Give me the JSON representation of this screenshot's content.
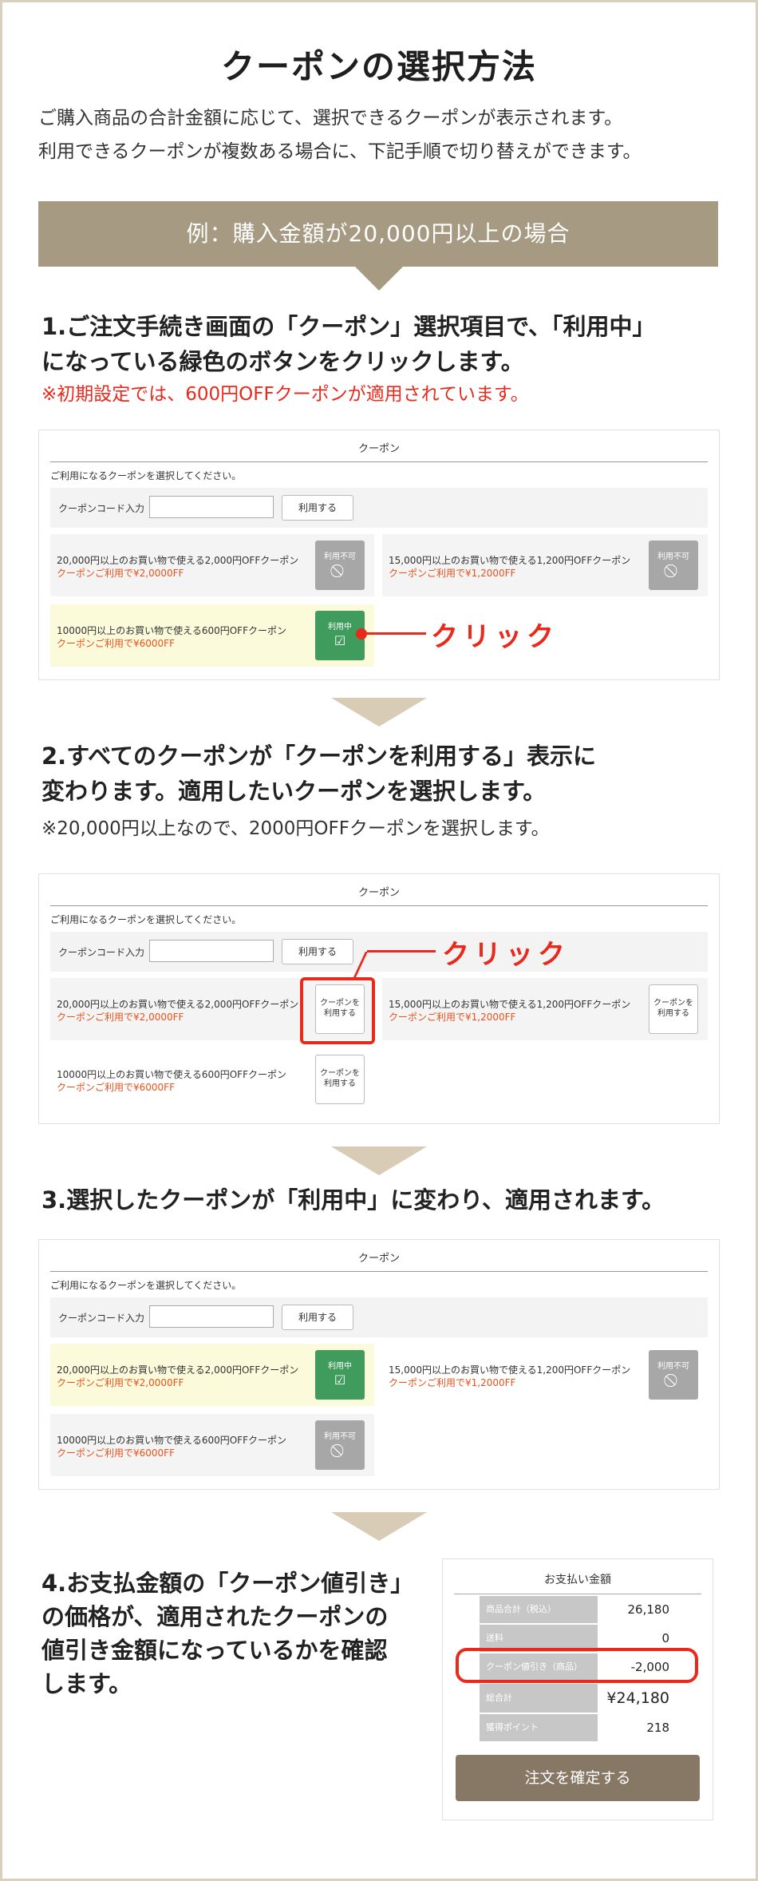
{
  "page": {
    "title": "クーポンの選択方法",
    "intro": [
      "ご購入商品の合計金額に応じて、選択できるクーポンが表示されます。",
      "利用できるクーポンが複数ある場合に、下記手順で切り替えができます。"
    ],
    "example_banner": "例：購入金額が20,000円以上の場合"
  },
  "steps": {
    "step1": [
      "1.ご注文手続き画面の「クーポン」選択項目で、「利用中」",
      "になっている緑色のボタンをクリックします。"
    ],
    "step1_note": "※初期設定では、600円OFFクーポンが適用されています。",
    "step2": [
      "2.すべてのクーポンが「クーポンを利用する」表示に",
      "変わります。適用したいクーポンを選択します。"
    ],
    "step2_note": "※20,000円以上なので、2000円OFFクーポンを選択します。",
    "step3": "3.選択したクーポンが「利用中」に変わり、適用されます。",
    "step4": [
      "4.お支払金額の「クーポン値引き」",
      "の価格が、適用されたクーポンの",
      "値引き金額になっているかを確認",
      "します。"
    ]
  },
  "coupon_panel": {
    "header": "クーポン",
    "description": "ご利用になるクーポンを選択してください。",
    "code_label": "クーポンコード入力",
    "code_input_value": "",
    "apply_button": "利用する"
  },
  "coupons": {
    "c2000": {
      "title": "20,000円以上のお買い物で使える2,000円OFFクーポン",
      "sub": "クーポンご利用で¥2,0000FF"
    },
    "c1200": {
      "title": "15,000円以上のお買い物で使える1,200円OFFクーポン",
      "sub": "クーポンご利用で¥1,2000FF"
    },
    "c600": {
      "title": "10000円以上のお買い物で使える600円OFFクーポン",
      "sub": "クーポンご利用で¥6000FF"
    }
  },
  "button_states": {
    "disabled": "利用不可",
    "in_use": "利用中",
    "select": "クーポンを\n利用する",
    "disabled_icon": "⃠",
    "in_use_icon": "☑"
  },
  "annotations": {
    "click": "クリック",
    "accent_color": "#e8291c"
  },
  "payment_summary": {
    "header": "お支払い金額",
    "rows": [
      {
        "label": "商品合計（税込）",
        "value": "26,180"
      },
      {
        "label": "送料",
        "value": "0"
      },
      {
        "label": "クーポン値引き（商品）",
        "value": "-2,000"
      },
      {
        "label": "総合計",
        "value": "¥24,180"
      },
      {
        "label": "獲得ポイント",
        "value": "218"
      }
    ],
    "confirm_button": "注文を確定する"
  },
  "colors": {
    "banner": "#a79a82",
    "arrow": "#d8ccb6",
    "in_use_green": "#3f9c5d",
    "disabled_gray": "#a7a7a7",
    "active_bg": "#fbfadb",
    "confirm_button": "#877865"
  }
}
